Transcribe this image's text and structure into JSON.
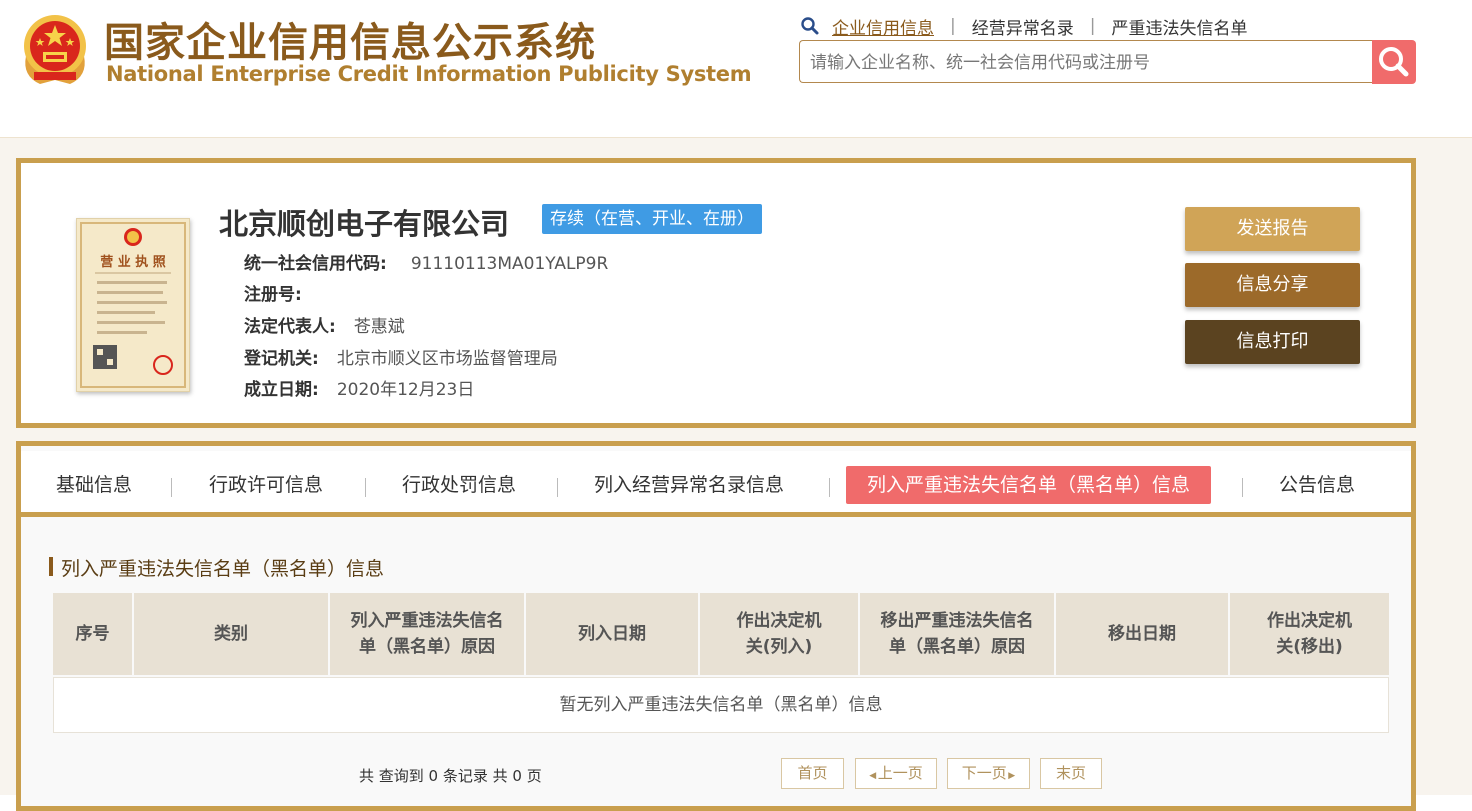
{
  "header": {
    "title_cn": "国家企业信用信息公示系统",
    "title_en": "National Enterprise Credit Information Publicity System",
    "nav": [
      {
        "label": "企业信用信息",
        "active": true
      },
      {
        "label": "经营异常名录"
      },
      {
        "label": "严重违法失信名单"
      }
    ],
    "search": {
      "placeholder": "请输入企业名称、统一社会信用代码或注册号",
      "value": ""
    }
  },
  "company": {
    "name": "北京顺创电子有限公司",
    "status": "存续（在营、开业、在册）",
    "license_caption": "营 业 执 照",
    "fields": [
      {
        "label": "统一社会信用代码:",
        "value": "91110113MA01YALP9R"
      },
      {
        "label": "注册号:",
        "value": ""
      },
      {
        "label": "法定代表人:",
        "value": "苍惠斌"
      },
      {
        "label": "登记机关:",
        "value": "北京市顺义区市场监督管理局"
      },
      {
        "label": "成立日期:",
        "value": "2020年12月23日"
      }
    ],
    "actions": {
      "send": "发送报告",
      "share": "信息分享",
      "print": "信息打印"
    }
  },
  "tabs": [
    {
      "label": "基础信息"
    },
    {
      "label": "行政许可信息"
    },
    {
      "label": "行政处罚信息"
    },
    {
      "label": "列入经营异常名录信息"
    },
    {
      "label": "列入严重违法失信名单（黑名单）信息",
      "active": true
    },
    {
      "label": "公告信息"
    }
  ],
  "section": {
    "title": "列入严重违法失信名单（黑名单）信息",
    "columns": [
      "序号",
      "类别",
      "列入严重违法失信名单（黑名单）原因",
      "列入日期",
      "作出决定机关(列入)",
      "移出严重违法失信名单（黑名单）原因",
      "移出日期",
      "作出决定机关(移出)"
    ],
    "empty_text": "暂无列入严重违法失信名单（黑名单）信息",
    "record_count": "共 查询到 0 条记录 共 0 页"
  },
  "pager": {
    "first": "首页",
    "prev": "上一页",
    "next": "下一页",
    "last": "末页"
  },
  "colors": {
    "gold": "#c99f4e",
    "brown": "#8a5a1c",
    "active_tab": "#f06b6b",
    "status": "#3f9be4"
  },
  "icons": {
    "search": "magnifier-icon",
    "emblem": "national-emblem-icon"
  }
}
